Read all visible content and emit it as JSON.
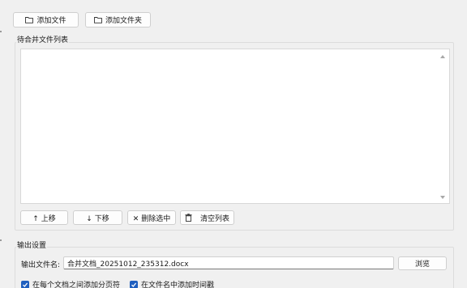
{
  "toolbar": {
    "add_file_label": "添加文件",
    "add_folder_label": "添加文件夹"
  },
  "file_list": {
    "title": "待合并文件列表",
    "items": []
  },
  "list_actions": {
    "move_up_label": "↑ 上移",
    "move_down_label": "↓ 下移",
    "delete_selected_label": "✕ 删除选中",
    "clear_list_label": "清空列表"
  },
  "output": {
    "title": "输出设置",
    "filename_label": "输出文件名:",
    "filename_value": "合并文档_20251012_235312.docx",
    "browse_label": "浏览"
  },
  "options": {
    "page_break_label": "在每个文档之间添加分页符",
    "page_break_checked": true,
    "timestamp_label": "在文件名中添加时间戳",
    "timestamp_checked": true
  },
  "colors": {
    "accent": "#1f5fbf",
    "background": "#f0f0f0"
  },
  "icons": {
    "add_file": "folder-icon",
    "add_folder": "folder-icon",
    "clear_list": "trash-icon"
  }
}
